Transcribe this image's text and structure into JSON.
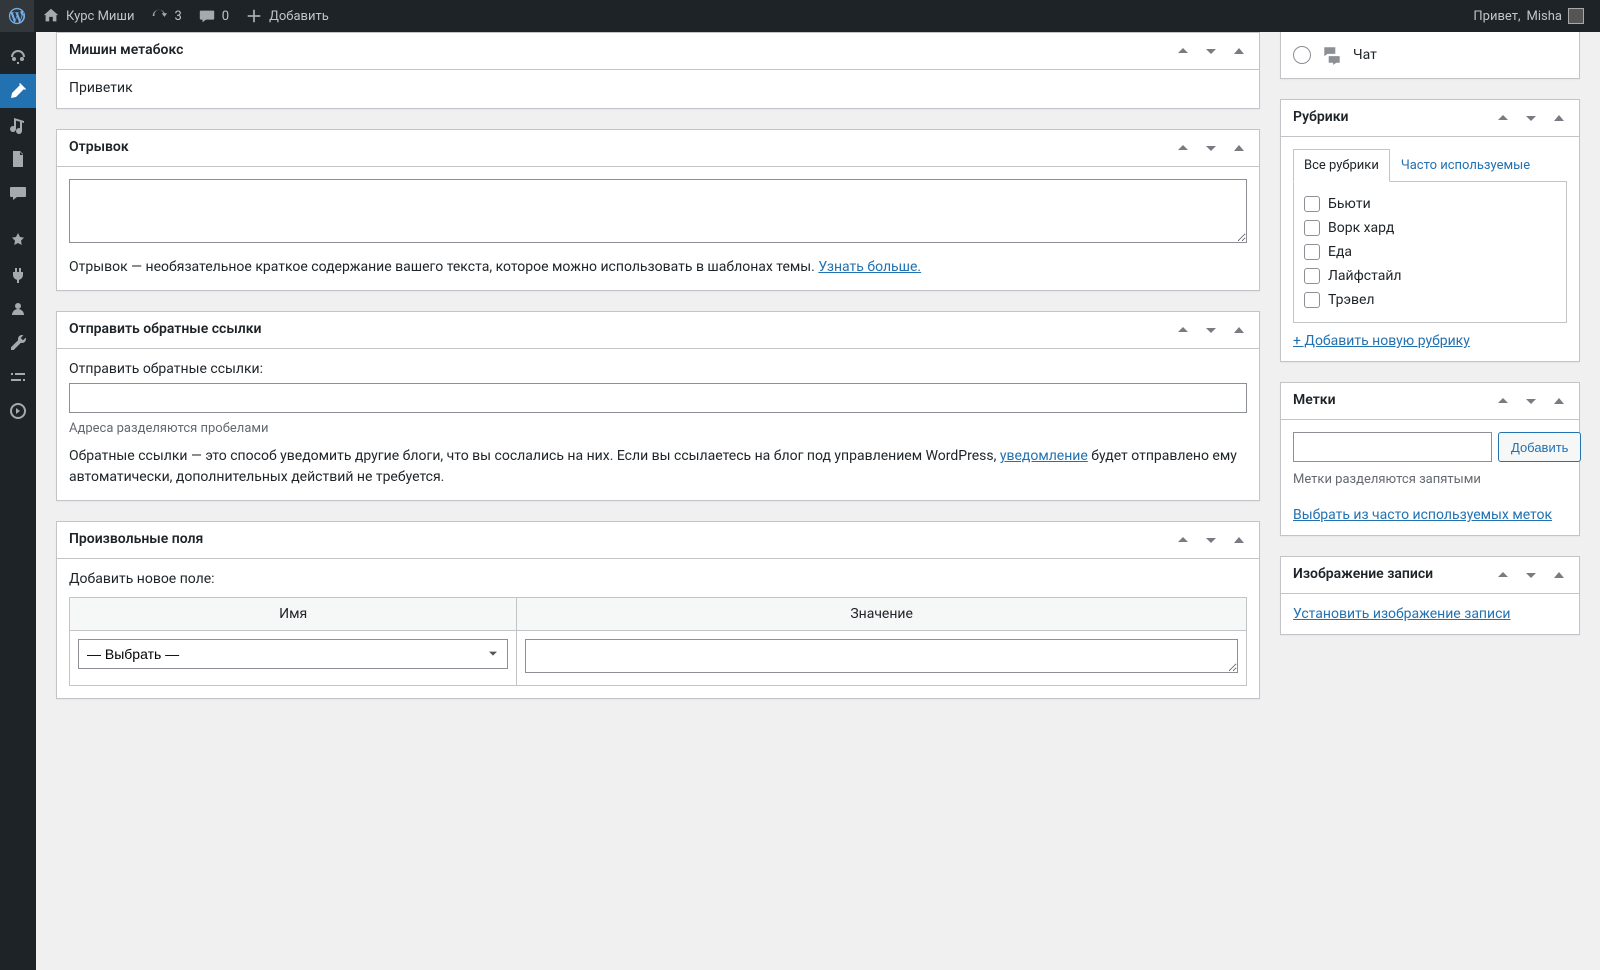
{
  "adminbar": {
    "site_name": "Курс Миши",
    "updates_count": "3",
    "comments_count": "0",
    "add_new": "Добавить",
    "greeting_prefix": "Привет, ",
    "user_name": "Misha"
  },
  "main": {
    "metabox": {
      "title": "Мишин метабокс",
      "content": "Приветик"
    },
    "excerpt": {
      "title": "Отрывок",
      "value": "",
      "desc": "Отрывок — необязательное краткое содержание вашего текста, которое можно использовать в шаблонах темы. ",
      "learn_more": "Узнать больше."
    },
    "trackbacks": {
      "title": "Отправить обратные ссылки",
      "label": "Отправить обратные ссылки:",
      "value": "",
      "hint": "Адреса разделяются пробелами",
      "desc_before": "Обратные ссылки — это способ уведомить другие блоги, что вы сослались на них. Если вы ссылаетесь на блог под управлением WordPress, ",
      "desc_link": "уведомление",
      "desc_after": " будет отправлено ему автоматически, дополнительных действий не требуется."
    },
    "custom_fields": {
      "title": "Произвольные поля",
      "add_label": "Добавить новое поле:",
      "col_name": "Имя",
      "col_value": "Значение",
      "select_placeholder": "— Выбрать —"
    }
  },
  "side": {
    "formats": {
      "chat": "Чат"
    },
    "categories": {
      "title": "Рубрики",
      "tab_all": "Все рубрики",
      "tab_freq": "Часто используемые",
      "items": [
        "Бьюти",
        "Ворк хард",
        "Еда",
        "Лайфстайл",
        "Трэвел"
      ],
      "add_new": "+ Добавить новую рубрику"
    },
    "tags": {
      "title": "Метки",
      "button": "Добавить",
      "hint": "Метки разделяются запятыми",
      "choose": "Выбрать из часто используемых меток"
    },
    "thumb": {
      "title": "Изображение записи",
      "set": "Установить изображение записи"
    }
  }
}
